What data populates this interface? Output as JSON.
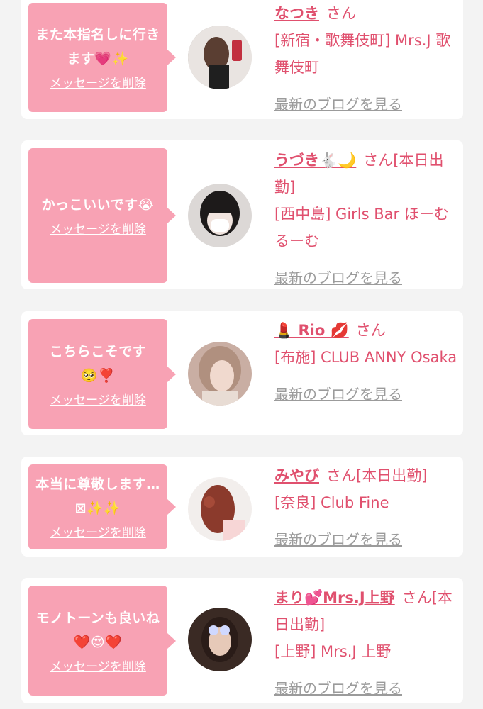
{
  "messages": [
    {
      "message": "また本指名しに行きます💗✨",
      "delete_label": "メッセージを削除",
      "name": "なつき",
      "honorific": "さん",
      "location": "[新宿・歌舞伎町] Mrs.J 歌舞伎町",
      "blog_label": "最新のブログを見る"
    },
    {
      "message": "かっこいいです😭",
      "delete_label": "メッセージを削除",
      "name": "うづき🐇🌙",
      "honorific": "さん[本日出勤]",
      "location": "[西中島] Girls Bar ほーむるーむ",
      "blog_label": "最新のブログを見る"
    },
    {
      "message": "こちらこそです🥺❣️",
      "delete_label": "メッセージを削除",
      "name": "💄 Rio 💋",
      "honorific": "さん",
      "location": "[布施] CLUB ANNY Osaka",
      "blog_label": "最新のブログを見る"
    },
    {
      "message": "本当に尊敬します…⊠✨✨",
      "delete_label": "メッセージを削除",
      "name": "みやび",
      "honorific": "さん[本日出勤]",
      "location": "[奈良] Club Fine",
      "blog_label": "最新のブログを見る"
    },
    {
      "message": "モノトーンも良いね❤️😍❤️",
      "delete_label": "メッセージを削除",
      "name": "まり💕Mrs.J上野",
      "honorific": "さん[本日出勤]",
      "location": "[上野] Mrs.J 上野",
      "blog_label": "最新のブログを見る"
    }
  ],
  "colors": {
    "accent": "#e0506e",
    "bubble": "#f8a2b4",
    "link_gray": "#9b9b9b",
    "background": "#f3f3f3"
  }
}
